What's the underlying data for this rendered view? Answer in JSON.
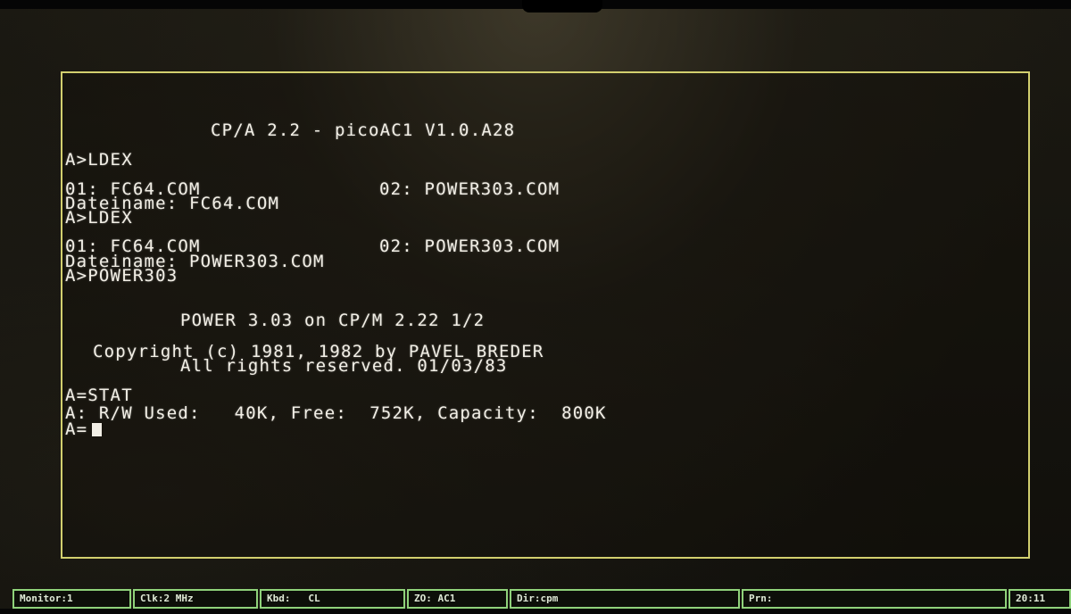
{
  "terminal": {
    "lines": [
      "CP/A 2.2 - picoAC1 V1.0.A28",
      "A>LDEX",
      "01: FC64.COM",
      "02: POWER303.COM",
      "Dateiname: FC64.COM",
      "A>LDEX",
      "01: FC64.COM",
      "02: POWER303.COM",
      "Dateiname: POWER303.COM",
      "A>POWER303",
      "POWER 3.03 on CP/M 2.22 1/2",
      "Copyright (c) 1981, 1982 by PAVEL BREDER",
      "All rights reserved. 01/03/83",
      "A=STAT",
      "A: R/W Used:   40K, Free:  752K, Capacity:  800K",
      "A="
    ]
  },
  "status_bar": {
    "monitor": "Monitor:1",
    "clk": "Clk:2 MHz",
    "kbd": "Kbd:   CL",
    "zo": "ZO: AC1",
    "dir": "Dir:cpm",
    "prn": "Prn:",
    "time": "20:11"
  },
  "colors": {
    "frame": "#d2cf6e",
    "text": "#f2efe6",
    "status_border": "#8fd27a",
    "background": "#14120d"
  }
}
